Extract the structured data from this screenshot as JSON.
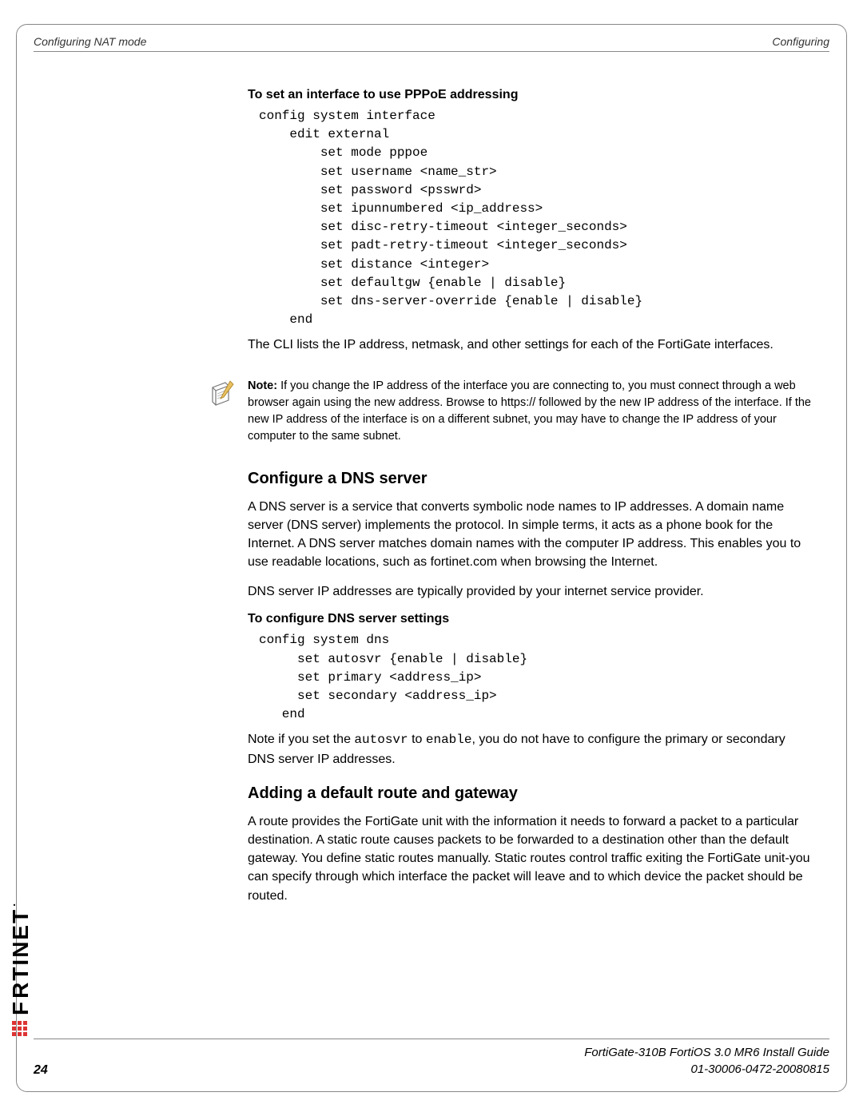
{
  "header": {
    "left": "Configuring NAT mode",
    "right": "Configuring"
  },
  "section1": {
    "title": "To set an interface to use PPPoE addressing",
    "code": "config system interface\n    edit external\n        set mode pppoe\n        set username <name_str>\n        set password <psswrd>\n        set ipunnumbered <ip_address>\n        set disc-retry-timeout <integer_seconds>\n        set padt-retry-timeout <integer_seconds>\n        set distance <integer>\n        set defaultgw {enable | disable}\n        set dns-server-override {enable | disable}\n    end",
    "after": "The CLI lists the IP address, netmask, and other settings for each of the FortiGate interfaces."
  },
  "note": {
    "label": "Note:",
    "text": " If you change the IP address of the interface you are connecting to, you must connect through a web browser again using the new address. Browse to https:// followed by the new IP address of the interface. If the new IP address of the interface is on a different subnet, you may have to change the IP address of your computer to the same subnet."
  },
  "section2": {
    "title": "Configure a DNS server",
    "p1": "A DNS server is a service that converts symbolic node names to IP addresses. A domain name server (DNS server) implements the protocol. In simple terms, it acts as a phone book for the Internet. A DNS server matches domain names with the computer IP address. This enables you to use readable locations, such as fortinet.com when browsing the Internet.",
    "p2": "DNS server IP addresses are typically provided by your internet service provider.",
    "subtitle": "To configure DNS server settings",
    "code": "config system dns\n     set autosvr {enable | disable}\n     set primary <address_ip>\n     set secondary <address_ip>\n   end",
    "p3a": "Note if you set the ",
    "p3mono1": "autosvr",
    "p3b": " to ",
    "p3mono2": "enable",
    "p3c": ", you do not have to configure the primary or secondary DNS server IP addresses."
  },
  "section3": {
    "title": "Adding a default route and gateway",
    "p1": "A route provides the FortiGate unit with the information it needs to forward a packet to a particular destination. A static route causes packets to be forwarded to a destination other than the default gateway. You define static routes manually. Static routes control traffic exiting the FortiGate unit-you can specify through which interface the packet will leave and to which device the packet should be routed."
  },
  "logo": {
    "text": "RTINET"
  },
  "footer": {
    "page": "24",
    "line1": "FortiGate-310B FortiOS 3.0 MR6 Install Guide",
    "line2": "01-30006-0472-20080815"
  }
}
